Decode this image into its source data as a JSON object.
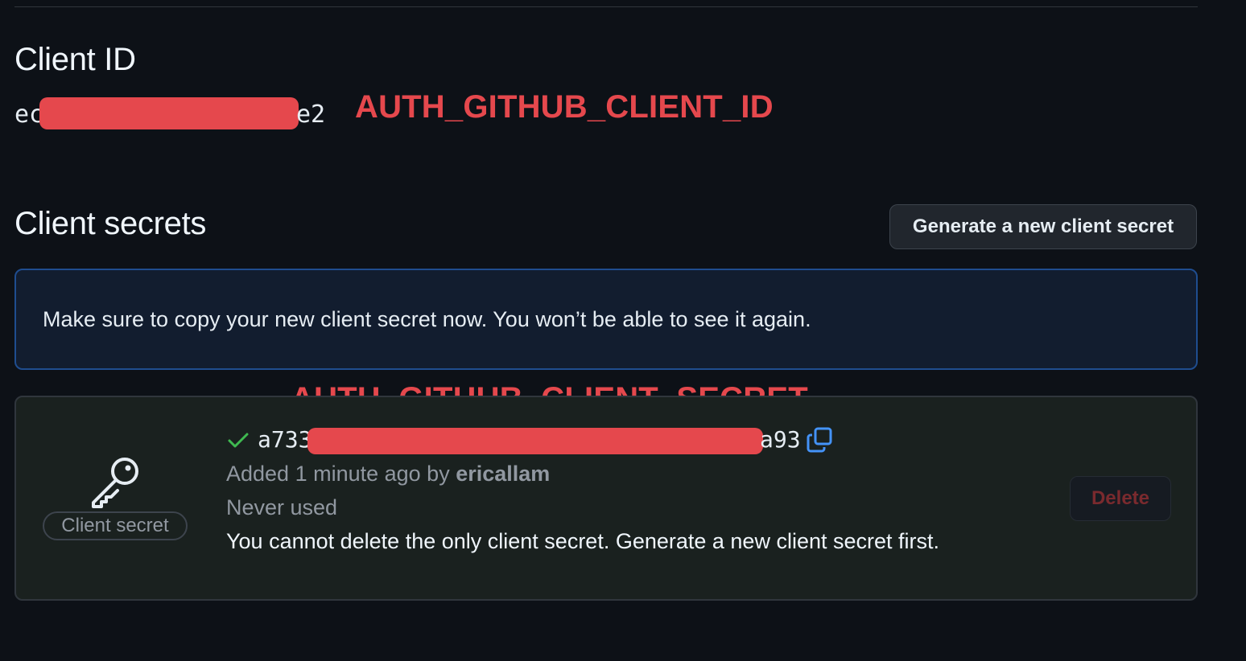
{
  "client_id": {
    "heading": "Client ID",
    "value_prefix": "ec",
    "value_suffix": "e2",
    "annotation": "AUTH_GITHUB_CLIENT_ID"
  },
  "client_secrets": {
    "heading": "Client secrets",
    "generate_button_label": "Generate a new client secret",
    "flash_message": "Make sure to copy your new client secret now. You won’t be able to see it again.",
    "annotation": "AUTH_GITHUB_CLIENT_SECRET",
    "secret": {
      "badge_label": "Client secret",
      "value_prefix": "a733",
      "value_suffix": "a93",
      "added_prefix": "Added 1 minute ago by ",
      "added_by": "ericallam",
      "usage": "Never used",
      "delete_warning": "You cannot delete the only client secret. Generate a new client secret first.",
      "delete_button_label": "Delete"
    }
  },
  "icons": {
    "key": "key-icon",
    "check": "check-icon",
    "copy": "copy-icon"
  },
  "colors": {
    "background": "#0d1117",
    "annotation_red": "#e5484d",
    "flash_border": "#1f4d8f",
    "check_green": "#3fb950",
    "copy_blue": "#4493f8"
  }
}
